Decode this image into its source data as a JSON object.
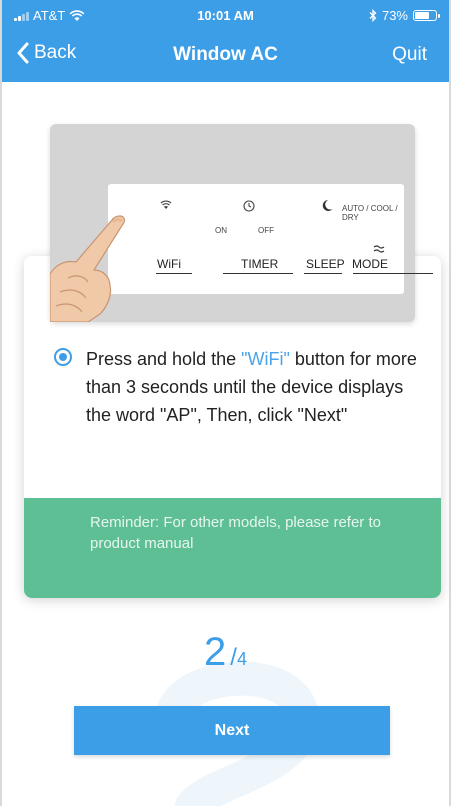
{
  "status_bar": {
    "carrier": "AT&T",
    "time": "10:01 AM",
    "battery": "73%"
  },
  "nav": {
    "back_label": "Back",
    "title": "Window AC",
    "quit_label": "Quit"
  },
  "remote_panel": {
    "buttons": [
      "WiFi",
      "TIMER",
      "SLEEP",
      "MODE"
    ],
    "on_label": "ON",
    "off_label": "OFF",
    "mode_text": "AUTO / COOL / DRY"
  },
  "instruction": {
    "before": "Press and hold the ",
    "highlight": "\"WiFi\"",
    "after": " button for more than 3 seconds until the device displays the word \"AP\", Then, click \"Next\""
  },
  "reminder": "Reminder: For other models, please refer to product manual",
  "pager": {
    "current": "2",
    "separator": "/",
    "total": "4"
  },
  "next_label": "Next",
  "colors": {
    "accent": "#3d9ee8",
    "reminder_bg": "#5fbf94"
  }
}
